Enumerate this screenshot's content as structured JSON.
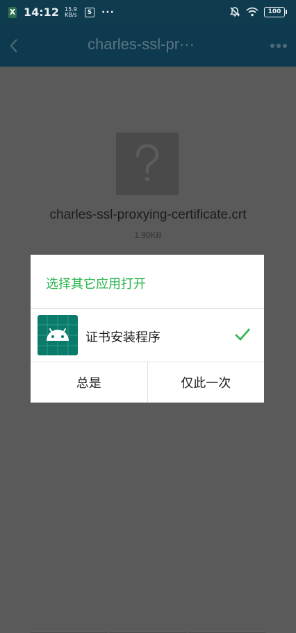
{
  "status_bar": {
    "time": "14:12",
    "speed_value": "15.9",
    "speed_unit": "KB/s",
    "more": "···",
    "battery": "100"
  },
  "toolbar": {
    "title": "charles-ssl-pr···"
  },
  "file": {
    "name": "charles-ssl-proxying-certificate.crt",
    "size": "1.90KB",
    "icon": "unknown-file-icon"
  },
  "dialog": {
    "title": "选择其它应用打开",
    "app": {
      "label": "证书安装程序",
      "icon": "android-icon",
      "selected": true
    },
    "always_label": "总是",
    "once_label": "仅此一次"
  },
  "colors": {
    "accent_green": "#28b34a",
    "toolbar_bg": "#0e3a4f",
    "overlay_bg": "#5a5a5a",
    "app_icon_bg": "#0a7a6a"
  }
}
